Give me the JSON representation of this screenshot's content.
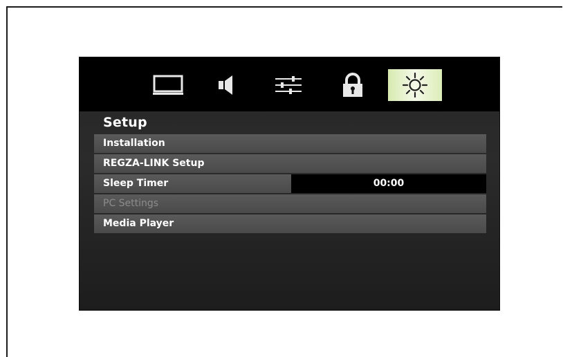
{
  "tabs": [
    {
      "icon": "picture-icon",
      "selected": false
    },
    {
      "icon": "speaker-icon",
      "selected": false
    },
    {
      "icon": "sliders-icon",
      "selected": false
    },
    {
      "icon": "lock-icon",
      "selected": false
    },
    {
      "icon": "sun-icon",
      "selected": true
    }
  ],
  "menu": {
    "title": "Setup",
    "items": [
      {
        "label": "Installation",
        "enabled": true
      },
      {
        "label": "REGZA-LINK Setup",
        "enabled": true
      },
      {
        "label": "Sleep Timer",
        "enabled": true,
        "value": "00:00"
      },
      {
        "label": "PC Settings",
        "enabled": false
      },
      {
        "label": "Media Player",
        "enabled": true
      }
    ]
  },
  "colors": {
    "selected_tab": "#e6f2cc",
    "row_bg": "#505050",
    "disabled_text": "#8c8c8c"
  }
}
